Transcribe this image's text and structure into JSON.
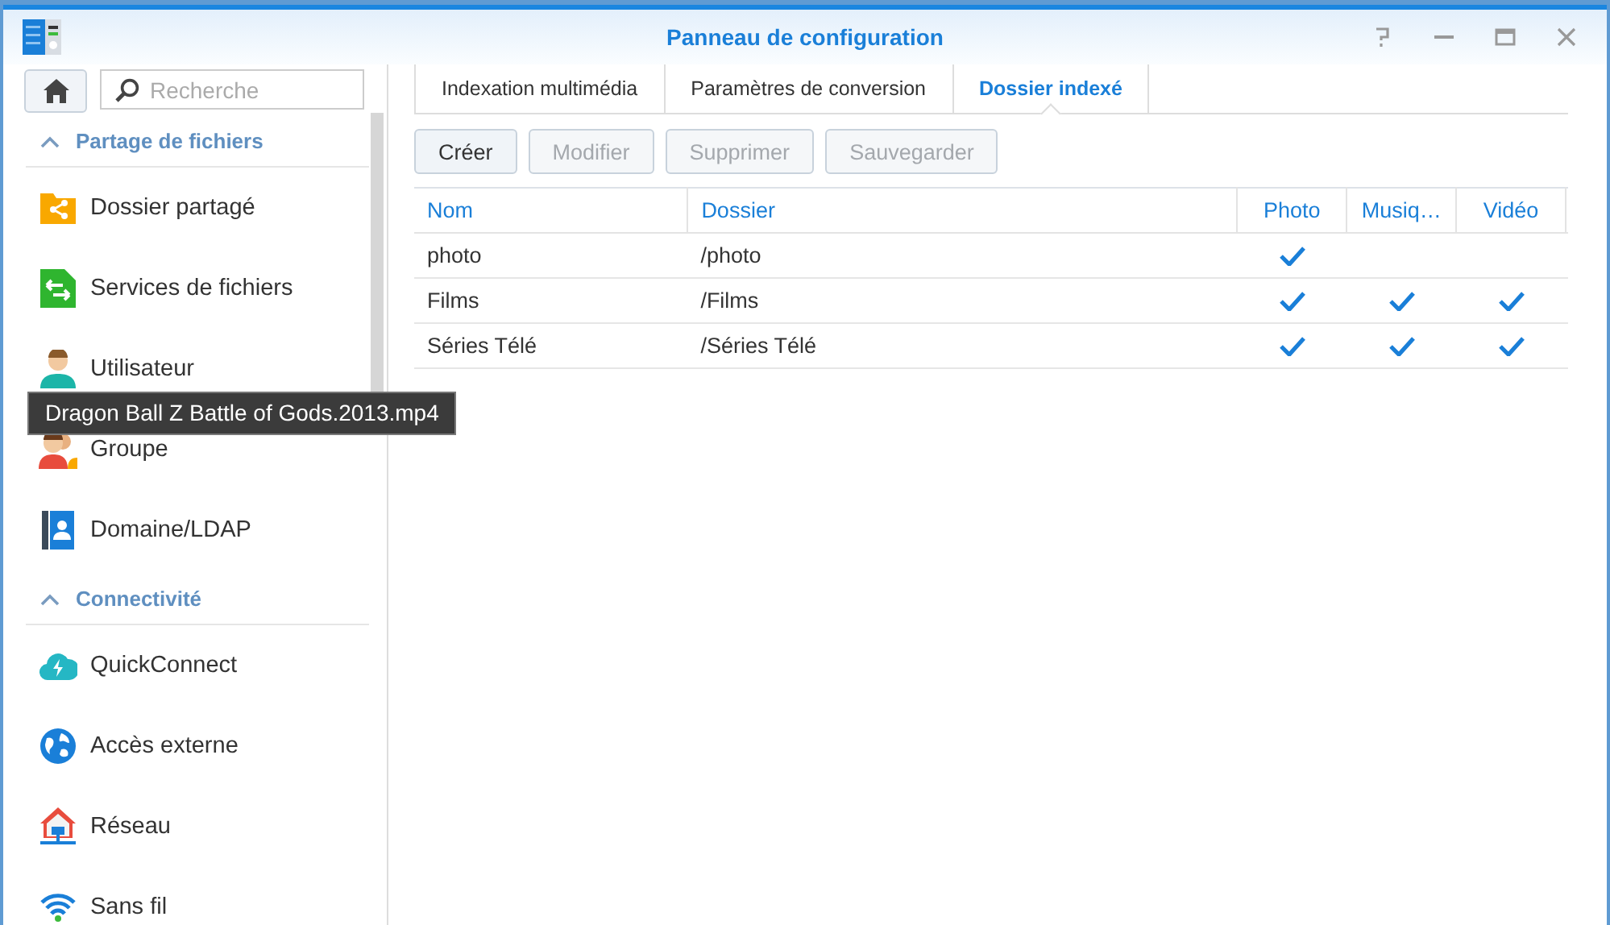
{
  "window": {
    "title": "Panneau de configuration"
  },
  "search": {
    "placeholder": "Recherche"
  },
  "sidebar": {
    "sections": [
      {
        "title": "Partage de fichiers",
        "expanded": true,
        "items": [
          {
            "label": "Dossier partagé",
            "kind": "shared-folder"
          },
          {
            "label": "Services de fichiers",
            "kind": "file-services"
          },
          {
            "label": "Utilisateur",
            "kind": "user"
          },
          {
            "label": "Groupe",
            "kind": "group"
          },
          {
            "label": "Domaine/LDAP",
            "kind": "domain"
          }
        ]
      },
      {
        "title": "Connectivité",
        "expanded": true,
        "items": [
          {
            "label": "QuickConnect",
            "kind": "cloud"
          },
          {
            "label": "Accès externe",
            "kind": "globe"
          },
          {
            "label": "Réseau",
            "kind": "network"
          },
          {
            "label": "Sans fil",
            "kind": "wifi"
          }
        ]
      }
    ]
  },
  "tooltip": {
    "text": "Dragon Ball Z Battle of Gods.2013.mp4"
  },
  "tabs": [
    {
      "label": "Indexation multimédia",
      "selected": false
    },
    {
      "label": "Paramètres de conversion",
      "selected": false
    },
    {
      "label": "Dossier indexé",
      "selected": true
    }
  ],
  "buttons": [
    {
      "label": "Créer",
      "disabled": false
    },
    {
      "label": "Modifier",
      "disabled": true
    },
    {
      "label": "Supprimer",
      "disabled": true
    },
    {
      "label": "Sauvegarder",
      "disabled": true
    }
  ],
  "table": {
    "columns": [
      "Nom",
      "Dossier",
      "Photo",
      "Musiq…",
      "Vidéo"
    ],
    "rows": [
      {
        "name": "photo",
        "folder": "/photo",
        "photo": true,
        "music": false,
        "video": false
      },
      {
        "name": "Films",
        "folder": "/Films",
        "photo": true,
        "music": true,
        "video": true
      },
      {
        "name": "Séries Télé",
        "folder": "/Séries Télé",
        "photo": true,
        "music": true,
        "video": true
      }
    ]
  }
}
